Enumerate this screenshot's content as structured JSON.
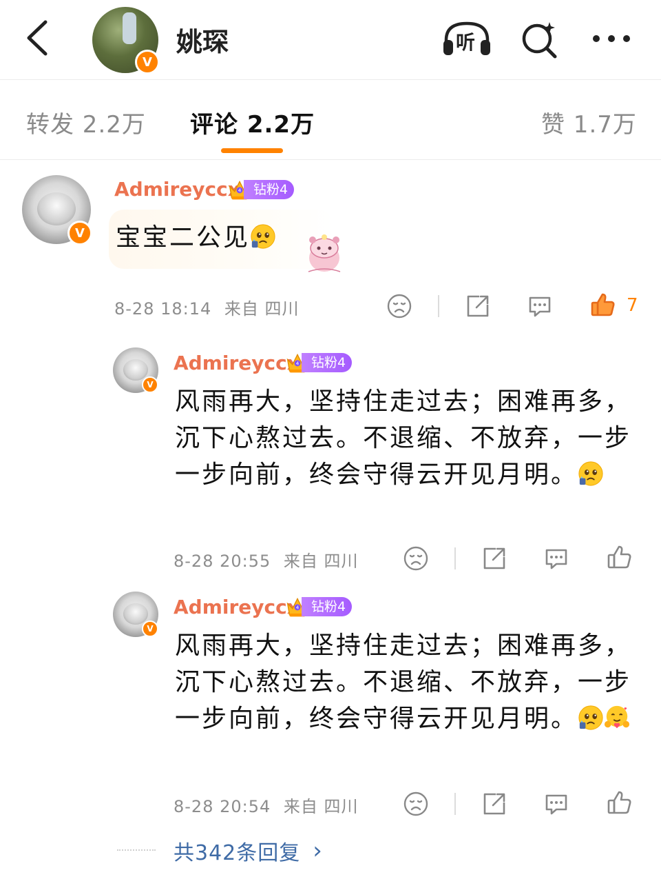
{
  "header": {
    "title": "姚琛",
    "verified_mark": "V",
    "back_icon": "chevron-left-icon",
    "listen_label": "听",
    "search_icon": "search-sparkle-icon",
    "more_icon": "more-horizontal-icon"
  },
  "tabs": [
    {
      "label": "转发 2.2万",
      "active": false
    },
    {
      "label": "评论 2.2万",
      "active": true
    },
    {
      "label": "赞 1.7万",
      "active": false
    }
  ],
  "colors": {
    "accent": "#ff8200",
    "username": "#eb7350",
    "fan_badge": "#a55bff",
    "link": "#3f6ba6"
  },
  "comments": [
    {
      "username": "Admireyccx",
      "fan_badge": "钻粉4",
      "text": "宝宝二公见",
      "emojis": [
        "crying-pleading-emoji"
      ],
      "sticker": "pink-character-sticker",
      "time": "8-28 18:14",
      "location": "来自 四川",
      "likes": "7",
      "liked": true
    },
    {
      "username": "Admireyccx",
      "fan_badge": "钻粉4",
      "text": "风雨再大，坚持住走过去；困难再多，沉下心熬过去。不退缩、不放弃，一步一步向前，终会守得云开见月明。",
      "emojis": [
        "crying-pleading-emoji"
      ],
      "time": "8-28 20:55",
      "location": "来自 四川",
      "likes": "",
      "liked": false
    },
    {
      "username": "Admireyccx",
      "fan_badge": "钻粉4",
      "text": "风雨再大，坚持住走过去；困难再多，沉下心熬过去。不退缩、不放弃，一步一步向前，终会守得云开见月明。",
      "emojis": [
        "crying-pleading-emoji",
        "hugging-emoji"
      ],
      "time": "8-28 20:54",
      "location": "来自 四川",
      "likes": "",
      "liked": false
    }
  ],
  "more_replies": "共342条回复",
  "more_replies_chevron": "›"
}
